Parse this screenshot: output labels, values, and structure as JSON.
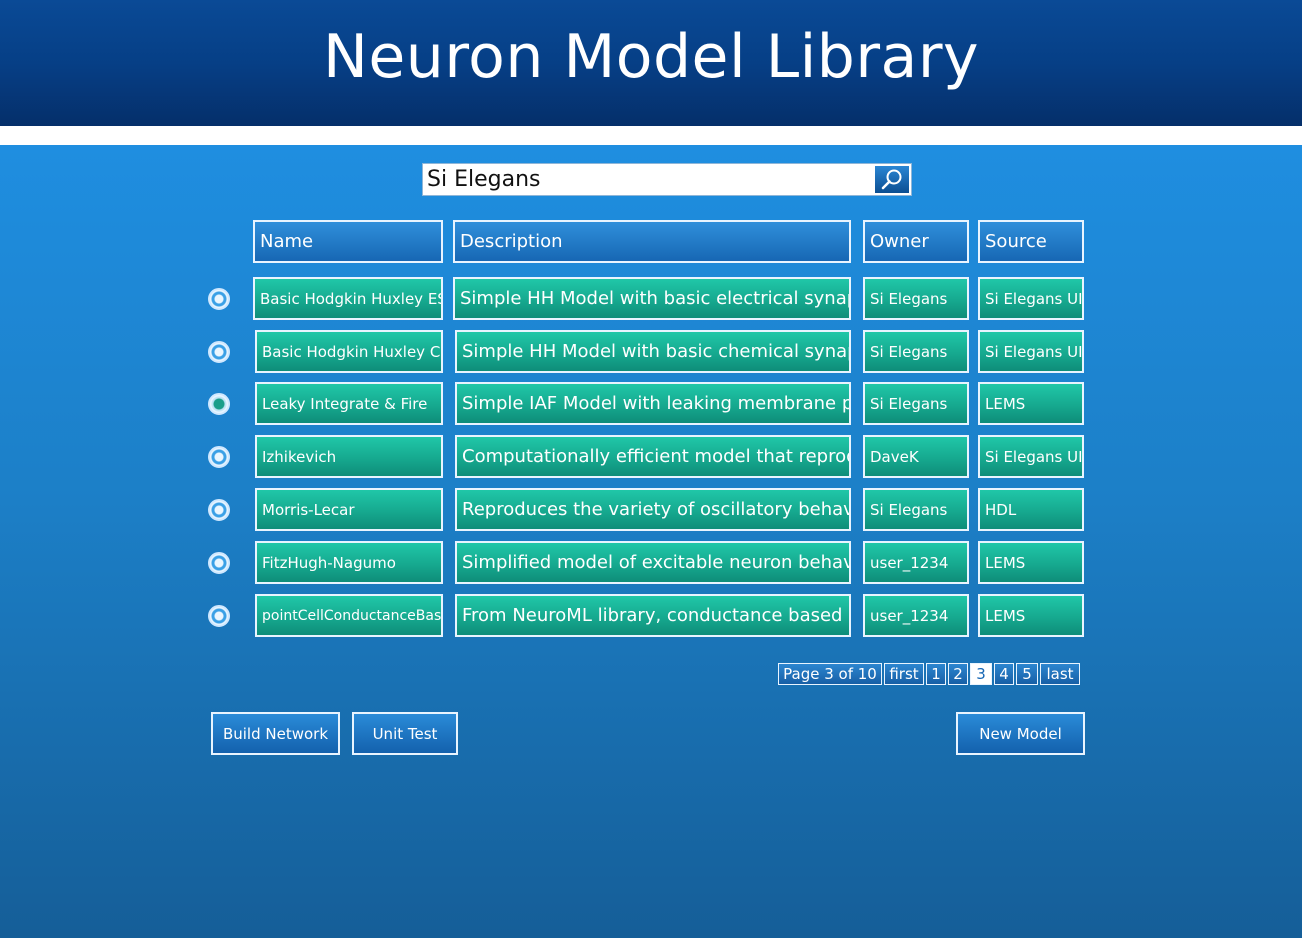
{
  "header": {
    "title": "Neuron Model Library"
  },
  "search": {
    "value": "Si Elegans"
  },
  "table": {
    "columns": [
      "Name",
      "Description",
      "Owner",
      "Source"
    ],
    "selected_row": 2,
    "rows": [
      {
        "name": "Basic Hodgkin Huxley ES",
        "description": "Simple HH Model with basic electrical synapse...",
        "owner": "Si Elegans",
        "source": "Si Elegans UI"
      },
      {
        "name": "Basic Hodgkin Huxley CS",
        "description": "Simple HH Model with basic chemical synapse...",
        "owner": "Si Elegans",
        "source": "Si Elegans UI"
      },
      {
        "name": "Leaky Integrate & Fire",
        "description": "Simple IAF Model with leaking membrane pot...",
        "owner": "Si Elegans",
        "source": "LEMS"
      },
      {
        "name": "Izhikevich",
        "description": "Computationally efficient model that reproduc...",
        "owner": "DaveK",
        "source": "Si Elegans UI"
      },
      {
        "name": "Morris-Lecar",
        "description": "Reproduces the variety of oscillatory behaviour...",
        "owner": "Si Elegans",
        "source": "HDL"
      },
      {
        "name": "FitzHugh-Nagumo",
        "description": "Simplified model of excitable neuron behaviour...",
        "owner": "user_1234",
        "source": "LEMS"
      },
      {
        "name": "pointCellConductanceBased",
        "description": "From NeuroML library, conductance based mo...",
        "owner": "user_1234",
        "source": "LEMS"
      }
    ]
  },
  "pagination": {
    "label": "Page 3 of 10",
    "first": "first",
    "pages": [
      "1",
      "2",
      "3",
      "4",
      "5"
    ],
    "current_page": "3",
    "last": "last"
  },
  "actions": {
    "build_network": "Build Network",
    "unit_test": "Unit Test",
    "new_model": "New Model"
  },
  "icons": {
    "search": "search-icon"
  }
}
